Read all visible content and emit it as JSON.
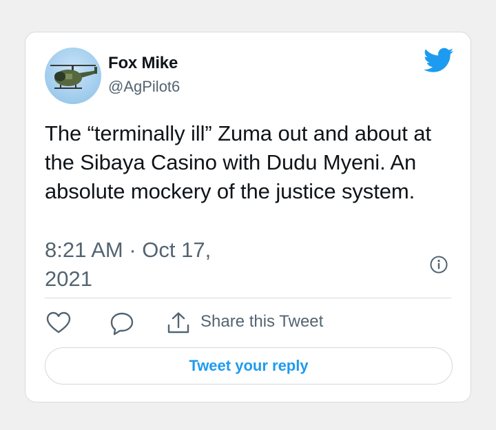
{
  "tweet": {
    "display_name": "Fox Mike",
    "handle": "@AgPilot6",
    "text": "The “terminally ill” Zuma out and about at the Sibaya Casino with Dudu Myeni. An absolute mockery of the justice system.",
    "timestamp_time": "8:21 AM · Oct 17,",
    "timestamp_year": "2021"
  },
  "actions": {
    "like_icon": "heart-icon",
    "reply_icon": "speech-bubble-icon",
    "share_icon": "share-upload-icon",
    "share_label": "Share this Tweet"
  },
  "reply_button": {
    "label": "Tweet your reply"
  },
  "icons": {
    "brand": "twitter-bird-icon",
    "info": "info-icon"
  },
  "colors": {
    "brand_blue": "#1d9bf0",
    "text_primary": "#0f1419",
    "text_secondary": "#536471",
    "border": "#cfd9de"
  }
}
